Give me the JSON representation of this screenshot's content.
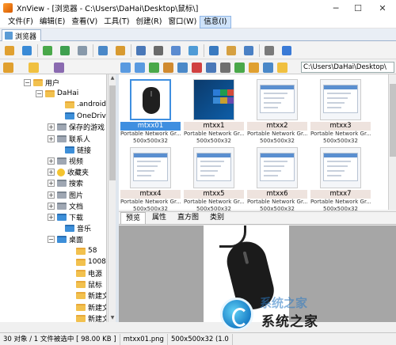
{
  "window": {
    "title": "XnView - [浏览器 - C:\\Users\\DaHai\\Desktop\\鼠标\\]",
    "minimize_glyph": "─",
    "maximize_glyph": "☐",
    "close_glyph": "✕"
  },
  "menu": [
    {
      "label": "文件(F)"
    },
    {
      "label": "编辑(E)"
    },
    {
      "label": "查看(V)"
    },
    {
      "label": "工具(T)"
    },
    {
      "label": "创建(R)"
    },
    {
      "label": "窗口(W)"
    },
    {
      "label": "信息(I)"
    }
  ],
  "tab": {
    "label": "浏览器"
  },
  "toolbar_colors": {
    "accent_blue": "#3f8fe0",
    "folder_yellow": "#f2c14e"
  },
  "path_box": {
    "value": "C:\\Users\\DaHai\\Desktop\\"
  },
  "tree": [
    {
      "label": "用户",
      "exp": "−",
      "icon": "folder"
    },
    {
      "label": "DaHai",
      "exp": "−",
      "icon": "folder"
    },
    {
      "label": ".android",
      "exp": "",
      "icon": "folder"
    },
    {
      "label": "OneDrive",
      "exp": "",
      "icon": "blue"
    },
    {
      "label": "保存的游戏",
      "exp": "+",
      "icon": "gray"
    },
    {
      "label": "联系人",
      "exp": "+",
      "icon": "gray"
    },
    {
      "label": "链接",
      "exp": "",
      "icon": "blue"
    },
    {
      "label": "视频",
      "exp": "+",
      "icon": "gray"
    },
    {
      "label": "收藏夹",
      "exp": "+",
      "icon": "star"
    },
    {
      "label": "搜索",
      "exp": "+",
      "icon": "gray"
    },
    {
      "label": "图片",
      "exp": "+",
      "icon": "gray"
    },
    {
      "label": "文档",
      "exp": "+",
      "icon": "gray"
    },
    {
      "label": "下载",
      "exp": "+",
      "icon": "blue"
    },
    {
      "label": "音乐",
      "exp": "",
      "icon": "blue"
    },
    {
      "label": "桌面",
      "exp": "−",
      "icon": "blue"
    },
    {
      "label": "58",
      "exp": "",
      "icon": "folder"
    },
    {
      "label": "10086",
      "exp": "",
      "icon": "folder"
    },
    {
      "label": "电源",
      "exp": "",
      "icon": "folder"
    },
    {
      "label": "鼠标",
      "exp": "",
      "icon": "folder"
    },
    {
      "label": "新建文件",
      "exp": "",
      "icon": "folder"
    },
    {
      "label": "新建文件",
      "exp": "",
      "icon": "folder"
    },
    {
      "label": "新建文件",
      "exp": "",
      "icon": "folder"
    }
  ],
  "thumbnails": [
    {
      "name": "mtxx01",
      "type": "Portable Network Gr...",
      "size": "500x500x32",
      "selected": true,
      "kind": "mouse"
    },
    {
      "name": "mtxx1",
      "type": "Portable Network Gr...",
      "size": "500x500x32",
      "selected": false,
      "kind": "desktop"
    },
    {
      "name": "mtxx2",
      "type": "Portable Network Gr...",
      "size": "500x500x32",
      "selected": false,
      "kind": "window"
    },
    {
      "name": "mtxx3",
      "type": "Portable Network Gr...",
      "size": "500x500x32",
      "selected": false,
      "kind": "window"
    },
    {
      "name": "mtxx4",
      "type": "Portable Network Gr...",
      "size": "500x500x32",
      "selected": false,
      "kind": "window"
    },
    {
      "name": "mtxx5",
      "type": "Portable Network Gr...",
      "size": "500x500x32",
      "selected": false,
      "kind": "window"
    },
    {
      "name": "mtxx6",
      "type": "Portable Network Gr...",
      "size": "500x500x32",
      "selected": false,
      "kind": "window"
    },
    {
      "name": "mtxx7",
      "type": "Portable Network Gr...",
      "size": "500x500x32",
      "selected": false,
      "kind": "window"
    }
  ],
  "preview_tabs": [
    {
      "label": "预览",
      "active": true
    },
    {
      "label": "属性",
      "active": false
    },
    {
      "label": "直方图",
      "active": false
    },
    {
      "label": "类别",
      "active": false
    }
  ],
  "status": {
    "count": "30 对象 / 1 文件被选中  [ 98.00 KB ]",
    "file": "mtxx01.png",
    "dims": "500x500x32 (1.0"
  },
  "watermark": {
    "text": "系统之家",
    "top": "系统之家"
  }
}
